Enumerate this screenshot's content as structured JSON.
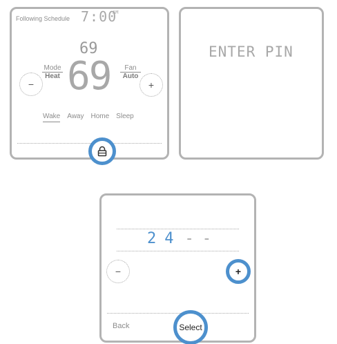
{
  "home_screen": {
    "schedule_status": "Following Schedule",
    "time": "7:00",
    "time_period": "AM",
    "setpoint": "69",
    "current_temp": "69",
    "mode_title": "Mode",
    "mode_value": "Heat",
    "fan_title": "Fan",
    "fan_value": "Auto",
    "decrease_label": "−",
    "increase_label": "+",
    "schedule_periods": [
      "Wake",
      "Away",
      "Home",
      "Sleep"
    ],
    "active_period": "Wake",
    "lock_icon": "lock-icon"
  },
  "pin_prompt": {
    "message": "ENTER PIN"
  },
  "pin_entry": {
    "digits": [
      "2",
      "4",
      "-",
      "-"
    ],
    "decrease_label": "−",
    "increase_label": "+",
    "back_label": "Back",
    "select_label": "Select"
  },
  "colors": {
    "highlight": "#4d90cd",
    "digit_active": "#4d90cd",
    "panel_border": "#b3b3b3",
    "segment_grey": "#a8a8a8"
  }
}
